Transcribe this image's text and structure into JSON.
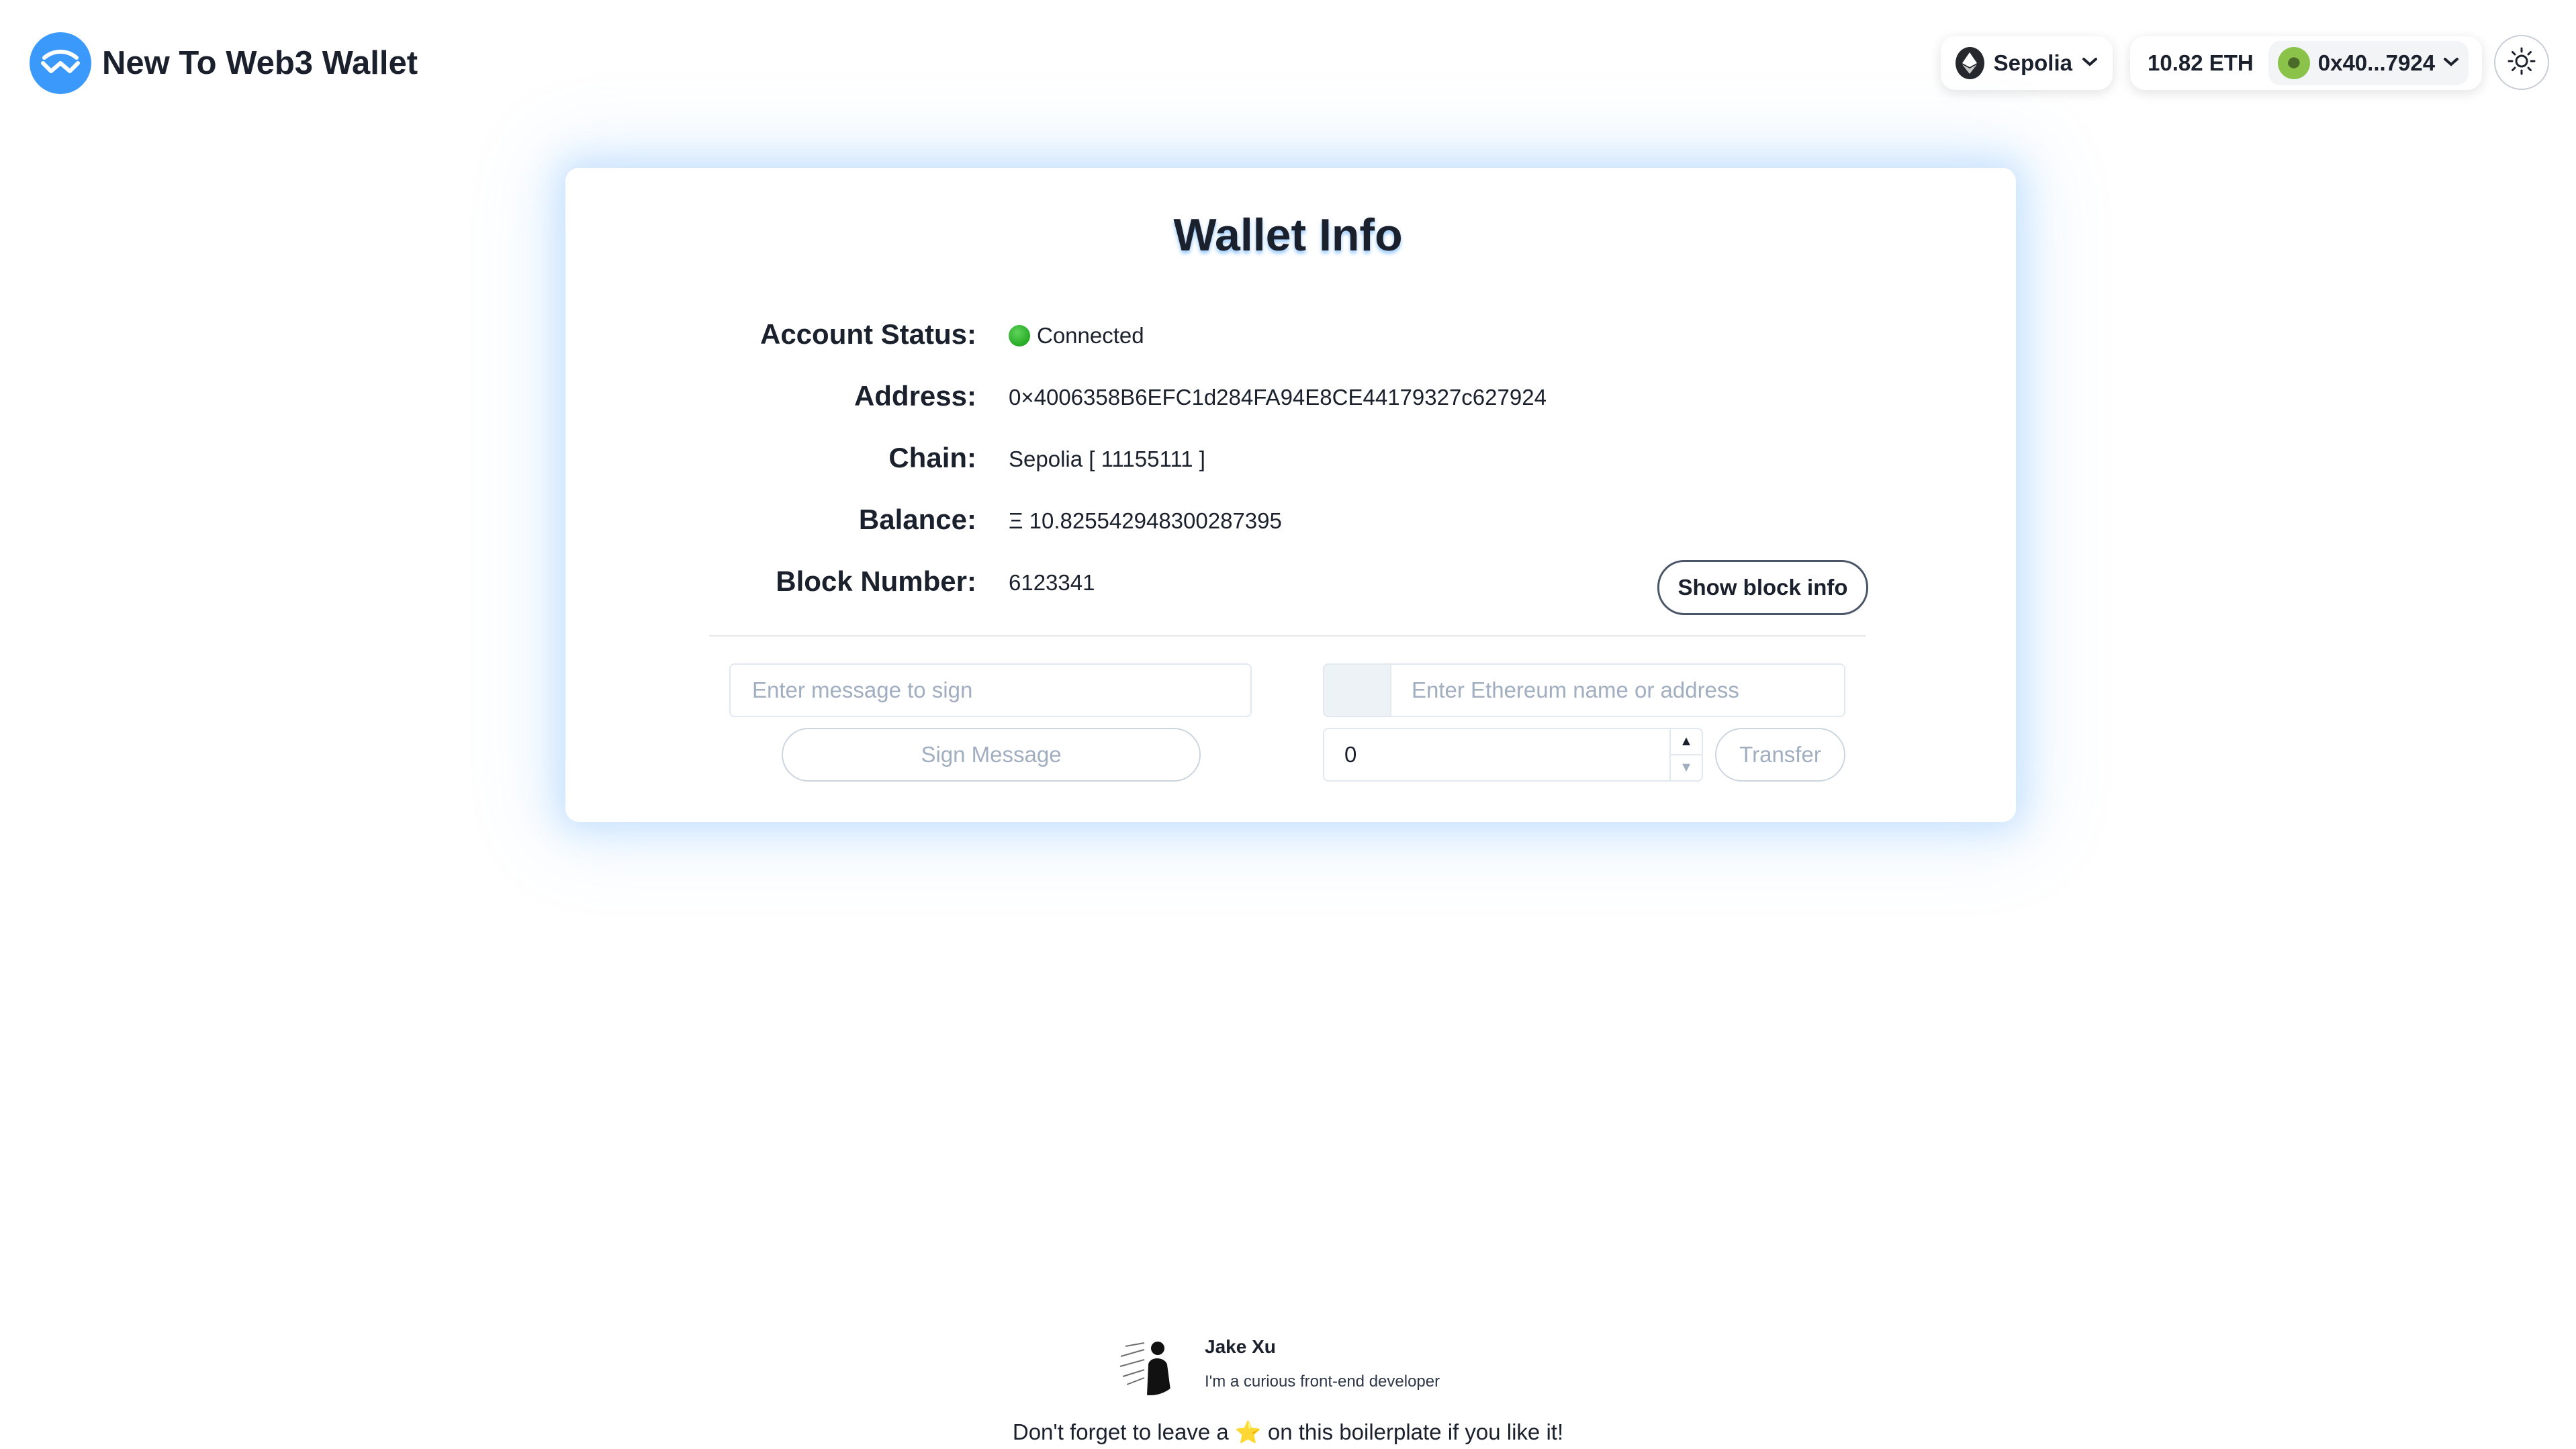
{
  "header": {
    "app_title": "New To Web3 Wallet",
    "logo_icon": "walletconnect-logo-icon",
    "network": {
      "name": "Sepolia",
      "icon": "ethereum-icon"
    },
    "account": {
      "balance": "10.82 ETH",
      "address_short": "0x40...7924",
      "avatar_icon": "account-avatar-icon"
    },
    "theme_toggle_icon": "sun-icon"
  },
  "card": {
    "title": "Wallet Info",
    "rows": [
      {
        "label": "Account Status:",
        "value": "Connected"
      },
      {
        "label": "Address:",
        "value": "0×4006358B6EFC1d284FA94E8CE44179327c627924"
      },
      {
        "label": "Chain:",
        "value": "Sepolia [ 11155111 ]"
      },
      {
        "label": "Balance:",
        "value": "Ξ 10.825542948300287395"
      },
      {
        "label": "Block Number:",
        "value": "6123341"
      }
    ],
    "block_button": "Show block info",
    "sign": {
      "placeholder": "Enter message to sign",
      "button": "Sign Message"
    },
    "transfer": {
      "address_placeholder": "Enter Ethereum name or address",
      "amount": "0",
      "button": "Transfer"
    }
  },
  "footer": {
    "author_name": "Jake Xu",
    "author_bio": "I'm a curious front-end developer",
    "note_before": "Don't forget to leave a",
    "star": "⭐",
    "note_after": "on this boilerplate if you like it!"
  },
  "colors": {
    "accent": "#3b99fc",
    "connected": "#0e9a0e",
    "avatar_green": "#8bc34a"
  }
}
